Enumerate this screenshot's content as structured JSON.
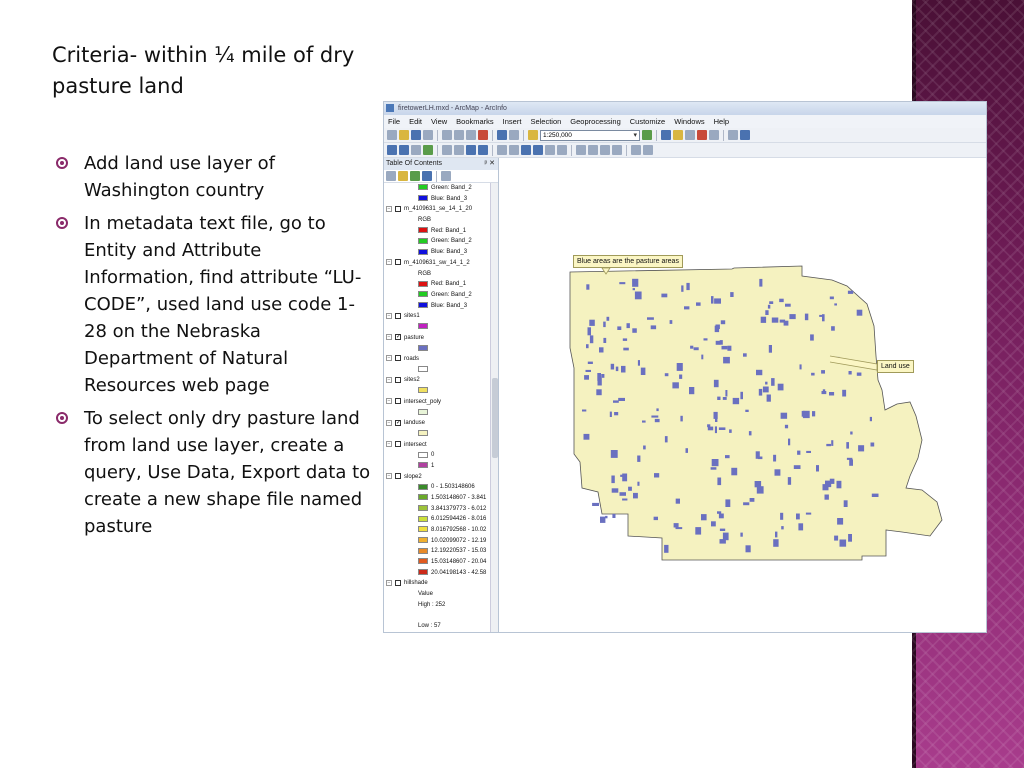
{
  "slide": {
    "title": "Criteria- within ¼ mile of dry pasture land",
    "bullets": [
      "Add land use layer of Washington country",
      "In metadata text file, go to Entity and Attribute Information, find attribute “LU-CODE”, used land use code 1-28 on the Nebraska Department of Natural Resources web page",
      "To select only dry pasture land from land use layer, create a query, Use Data, Export data to create a new shape file named pasture"
    ]
  },
  "colors": {
    "accent": "#8a2a6a",
    "land": "#f5f2c0",
    "pasture": "#6a70c0"
  },
  "window": {
    "title": "firetowerLH.mxd - ArcMap - ArcInfo",
    "menu": [
      "File",
      "Edit",
      "View",
      "Bookmarks",
      "Insert",
      "Selection",
      "Geoprocessing",
      "Customize",
      "Windows",
      "Help"
    ],
    "scale": "1:250,000"
  },
  "toc": {
    "title": "Table Of Contents",
    "items": [
      {
        "label": "Green: Band_2",
        "level": 2,
        "swatch": "#22cc22"
      },
      {
        "label": "Blue:   Band_3",
        "level": 2,
        "swatch": "#1010dd"
      },
      {
        "label": "m_4109631_se_14_1_20",
        "level": 0,
        "checked": false
      },
      {
        "label": "RGB",
        "level": 2
      },
      {
        "label": "Red:    Band_1",
        "level": 2,
        "swatch": "#dd1111"
      },
      {
        "label": "Green: Band_2",
        "level": 2,
        "swatch": "#22cc22"
      },
      {
        "label": "Blue:   Band_3",
        "level": 2,
        "swatch": "#1010dd"
      },
      {
        "label": "m_4109631_sw_14_1_2",
        "level": 0,
        "checked": false
      },
      {
        "label": "RGB",
        "level": 2
      },
      {
        "label": "Red:    Band_1",
        "level": 2,
        "swatch": "#dd1111"
      },
      {
        "label": "Green: Band_2",
        "level": 2,
        "swatch": "#22cc22"
      },
      {
        "label": "Blue:   Band_3",
        "level": 2,
        "swatch": "#1010dd"
      },
      {
        "label": "sites1",
        "level": 0,
        "checked": false
      },
      {
        "label": "",
        "level": 2,
        "swatch": "#c020c0"
      },
      {
        "label": "pasture",
        "level": 0,
        "checked": true
      },
      {
        "label": "",
        "level": 2,
        "swatch": "#6a70c0"
      },
      {
        "label": "roads",
        "level": 0,
        "checked": false
      },
      {
        "label": "",
        "level": 2,
        "swatch": "#ffffff"
      },
      {
        "label": "sites2",
        "level": 0,
        "checked": false
      },
      {
        "label": "",
        "level": 2,
        "swatch": "#f0e060"
      },
      {
        "label": "intersect_poly",
        "level": 0,
        "checked": false
      },
      {
        "label": "",
        "level": 2,
        "swatch": "#e8f4d8"
      },
      {
        "label": "landuse",
        "level": 0,
        "checked": true
      },
      {
        "label": "",
        "level": 2,
        "swatch": "#f5f2c0"
      },
      {
        "label": "intersect",
        "level": 0,
        "checked": false
      },
      {
        "label": "0",
        "level": 2,
        "swatch": "#ffffff"
      },
      {
        "label": "1",
        "level": 2,
        "swatch": "#b040a0"
      },
      {
        "label": "slope2",
        "level": 0,
        "checked": false
      },
      {
        "label": "0 - 1.503148606",
        "level": 2,
        "swatch": "#3a8a2a"
      },
      {
        "label": "1.503148607 - 3.841",
        "level": 2,
        "swatch": "#6aaa2a"
      },
      {
        "label": "3.841379773 - 6.012",
        "level": 2,
        "swatch": "#9cc23a"
      },
      {
        "label": "6.012594426 - 8.016",
        "level": 2,
        "swatch": "#cce03a"
      },
      {
        "label": "8.016792568 - 10.02",
        "level": 2,
        "swatch": "#f0e040"
      },
      {
        "label": "10.02099072 - 12.19",
        "level": 2,
        "swatch": "#f0b030"
      },
      {
        "label": "12.19220537 - 15.03",
        "level": 2,
        "swatch": "#e88a2a"
      },
      {
        "label": "15.03148607 - 20.04",
        "level": 2,
        "swatch": "#e05a20"
      },
      {
        "label": "20.04198143 - 42.58",
        "level": 2,
        "swatch": "#cc2a1a"
      },
      {
        "label": "hillshade",
        "level": 0,
        "checked": false
      },
      {
        "label": "Value",
        "level": 2
      },
      {
        "label": "High : 252",
        "level": 2
      },
      {
        "label": "",
        "level": 2
      },
      {
        "label": "Low : 57",
        "level": 2
      }
    ]
  },
  "map": {
    "callout_pasture": "Blue areas are the pasture areas",
    "callout_landuse": "Land use"
  }
}
